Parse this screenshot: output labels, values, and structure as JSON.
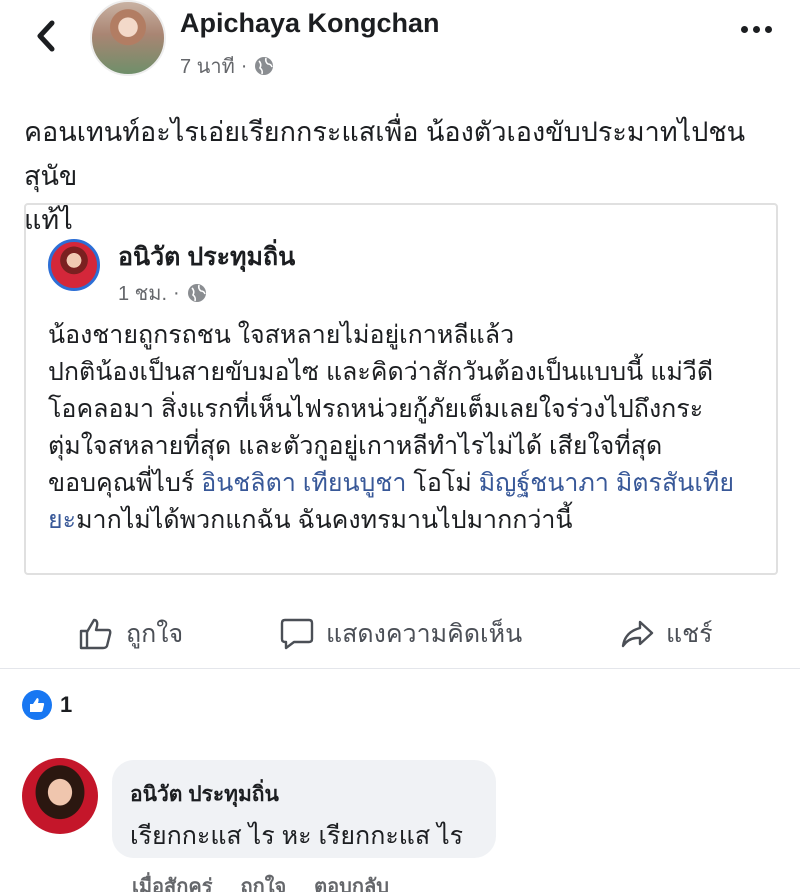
{
  "post": {
    "author": "Apichaya Kongchan",
    "time": "7 นาที",
    "privacy_icon": "globe-icon",
    "text_lines": [
      "คอนเทนท์อะไรเอ่ยเรียกกระแสเพื่อ น้องตัวเองขับประมาทไปชนสุนัข",
      "แท้ไ"
    ]
  },
  "shared": {
    "author": "อนิวัต ประทุมถิ่น",
    "time": "1 ชม.",
    "lines": [
      "น้องชายถูกรถชน ใจสหลายไม่อยู่เกาหลีแล้ว",
      "ปกติน้องเป็นสายขับมอไซ และคิดว่าสักวันต้องเป็นแบบนี้ แม่วีดี",
      "โอคลอมา สิ่งแรกที่เห็นไฟรถหน่วยกู้ภัยเต็มเลยใจร่วงไปถึงกระ",
      "ตุ่มใจสหลายที่สุด และตัวกูอยู่เกาหลีทำไรไม่ได้ เสียใจที่สุด"
    ],
    "line5_prefix": "ขอบคุณพี่ไบร์ ",
    "mention1": "อินชลิตา เทียนบูชา",
    "line5_mid": "โอโม่ ",
    "mention2_part1": "มิญฐ์ชนาภา มิตรสันเทีย",
    "mention2_part2": "ยะ",
    "line6_rest": "มากไม่ได้พวกแกฉัน ฉันคงทรมานไปมากกว่านี้"
  },
  "actions": {
    "like": "ถูกใจ",
    "comment": "แสดงความคิดเห็น",
    "share": "แชร์"
  },
  "reactions": {
    "count": "1"
  },
  "comment": {
    "author": "อนิวัต ประทุมถิ่น",
    "text": "เรียกกะแส ไร หะ เรียกกะแส ไร",
    "time": "เมื่อสักครู่",
    "like": "ถูกใจ",
    "reply": "ตอบกลับ"
  },
  "colors": {
    "link": "#385898",
    "like_blue": "#1877f2",
    "bubble_bg": "#f0f2f5"
  }
}
